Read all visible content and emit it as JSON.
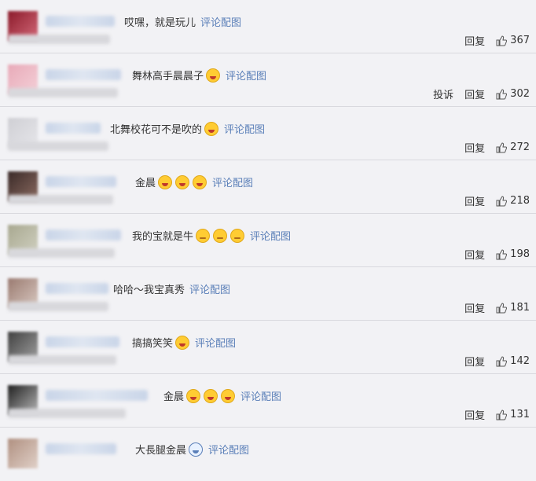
{
  "common": {
    "link": "评论配图",
    "reply": "回复",
    "report": "投诉"
  },
  "comments": [
    {
      "text": "哎嘿，就是玩儿",
      "likes": "367"
    },
    {
      "text": "舞林高手晨晨子",
      "likes": "302"
    },
    {
      "text": "北舞校花可不是吹的",
      "likes": "272"
    },
    {
      "text": "金晨",
      "likes": "218"
    },
    {
      "text": "我的宝就是牛",
      "likes": "198"
    },
    {
      "text": "哈哈～我宝真秀",
      "likes": "181"
    },
    {
      "text": "搞搞笑笑",
      "likes": "142"
    },
    {
      "text": "金晨",
      "likes": "131"
    },
    {
      "text": "大長腿金晨",
      "likes": ""
    }
  ]
}
